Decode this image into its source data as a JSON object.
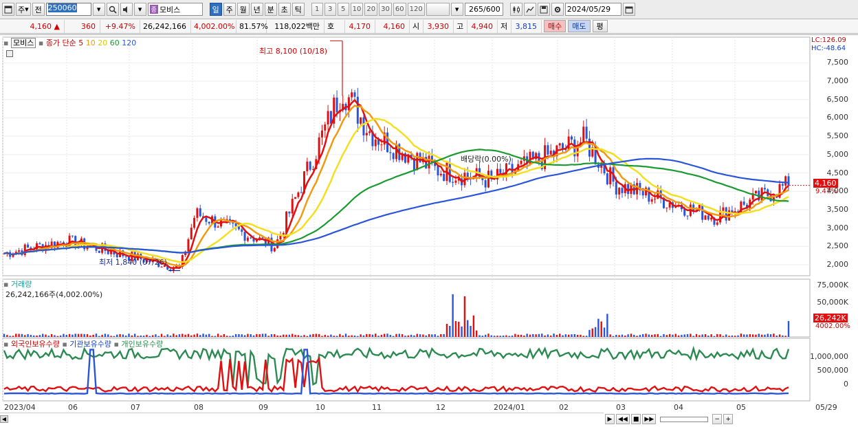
{
  "toolbar": {
    "period_type": "주",
    "prev_label": "전",
    "stock_code": "250060",
    "stock_badge": "종",
    "stock_name": "모비스",
    "period_buttons": [
      "일",
      "주",
      "월",
      "년",
      "분",
      "초",
      "틱"
    ],
    "active_period": "일",
    "interval_buttons": [
      "1",
      "3",
      "5",
      "10",
      "20",
      "30",
      "60",
      "120"
    ],
    "count_value": "265",
    "count_max": "/600",
    "date_value": "2024/05/29"
  },
  "quote": {
    "price": "4,160",
    "change_arrow": "▲",
    "change": "360",
    "change_rate": "+9.47%",
    "volume": "26,242,166",
    "volume_rate": "4,002.00%",
    "turnover_rate": "81.57%",
    "amount": "118,022백만",
    "ask_label": "호가",
    "ask_value": "4,170",
    "bid_value": "4,160",
    "open_label": "시",
    "open": "3,930",
    "high_label": "고",
    "high": "4,940",
    "low_label": "저",
    "low": "3,815",
    "buy_button": "매수",
    "sell_button": "매도",
    "eval_button": "평"
  },
  "main_panel": {
    "legend_box": "모비스",
    "legend_ma": "종가 단순",
    "ma_periods": [
      "5",
      "10",
      "20",
      "60",
      "120"
    ],
    "ma_colors": [
      "#e01010",
      "#f09a10",
      "#f2e020",
      "#1a9a30",
      "#2a55d8",
      "#1a9a9a"
    ],
    "lc_label": "LC:126.09",
    "hc_label": "HC:-48.64",
    "y_ticks": [
      "7,500",
      "7,000",
      "6,500",
      "6,000",
      "5,500",
      "5,000",
      "4,500",
      "4,000",
      "3,500",
      "3,000",
      "2,500",
      "2,000"
    ],
    "current_price_tag": "4,160",
    "current_rate_tag": "9.47%",
    "high_annotation": "최고 8,100 (10/18)",
    "low_annotation": "최저 1,840 (07/26)",
    "dividend_annotation": "배당락(0.00%)"
  },
  "volume_panel": {
    "title": "거래량",
    "value_text": "26,242,166주(4,002.00%)",
    "y_ticks": [
      "75,000K",
      "50,000K"
    ],
    "current_tag": "26,242K",
    "current_rate_tag": "4002.00%"
  },
  "holdings_panel": {
    "legend": [
      "외국인보유수량",
      "기관보유수량",
      "개인보유수량"
    ],
    "legend_colors": [
      "#e01010",
      "#2a55d8",
      "#2a8a50"
    ],
    "y_ticks": [
      "1,000,000",
      "500,000",
      "0"
    ]
  },
  "x_axis": {
    "labels": [
      "2023/04",
      "06",
      "07",
      "08",
      "09",
      "10",
      "11",
      "12",
      "2024/01",
      "02",
      "03",
      "04",
      "05",
      "05/29"
    ]
  },
  "colors": {
    "up": "#e01010",
    "down": "#2a55d8",
    "price_tag_bg": "#e01010"
  },
  "chart_data": {
    "type": "line",
    "title": "",
    "series_price_checkpoints": {
      "x": [
        "2023/04",
        "2023/06",
        "2023/07/26",
        "2023/08",
        "2023/09",
        "2023/10/18",
        "2023/11",
        "2023/12",
        "2024/01",
        "2024/02",
        "2024/03",
        "2024/04",
        "2024/05",
        "2024/05/29"
      ],
      "close": [
        2300,
        2650,
        1900,
        3400,
        2500,
        6800,
        5600,
        4600,
        4300,
        5400,
        4200,
        3300,
        3700,
        4160
      ]
    },
    "annotations": {
      "high": {
        "value": 8100,
        "date": "10/18"
      },
      "low": {
        "value": 1840,
        "date": "07/26"
      }
    },
    "ylim": [
      1700,
      8200
    ],
    "grid": true,
    "legend_position": "top-left"
  }
}
